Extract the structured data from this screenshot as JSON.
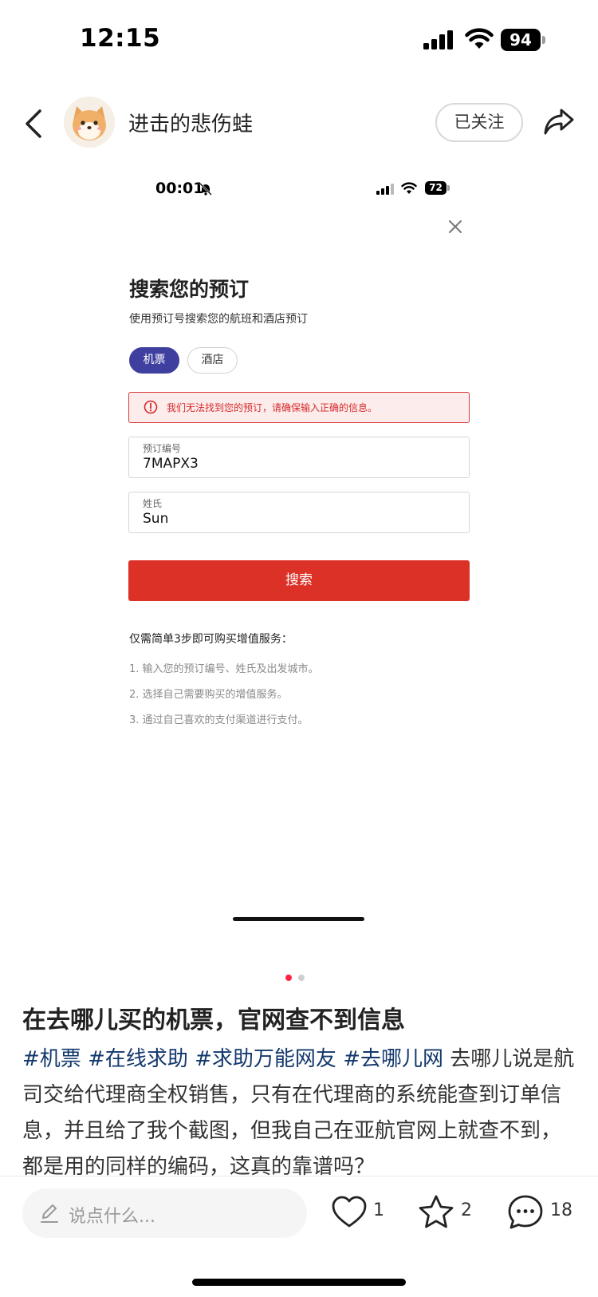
{
  "status_bar": {
    "time": "12:15",
    "battery": "94"
  },
  "header": {
    "author_name": "进击的悲伤蛙",
    "follow_label": "已关注"
  },
  "inner_screenshot": {
    "time": "00:01",
    "battery": "72",
    "title": "搜索您的预订",
    "subtitle": "使用预订号搜索您的航班和酒店预订",
    "tabs": [
      {
        "label": "机票",
        "selected": true
      },
      {
        "label": "酒店",
        "selected": false
      }
    ],
    "error_message": "我们无法找到您的预订，请确保输入正确的信息。",
    "fields": [
      {
        "label": "预订编号",
        "value": "7MAPX3"
      },
      {
        "label": "姓氏",
        "value": "Sun"
      }
    ],
    "search_button": "搜索",
    "steps_title": "仅需简单3步即可购买增值服务：",
    "steps": [
      "1. 输入您的预订编号、姓氏及出发城市。",
      "2. 选择自己需要购买的增值服务。",
      "3. 通过自己喜欢的支付渠道进行支付。"
    ]
  },
  "carousel": {
    "page_count": 2,
    "active_index": 0
  },
  "post": {
    "title": "在去哪儿买的机票，官网查不到信息",
    "tags": [
      "#机票",
      "#在线求助",
      "#求助万能网友",
      "#去哪儿网"
    ],
    "body": "去哪儿说是航司交给代理商全权销售，只有在代理商的系统能查到订单信息，并且给了我个截图，但我自己在亚航官网上就查不到，都是用的同样的编码，这真的靠谱吗？"
  },
  "bottom_bar": {
    "comment_placeholder": "说点什么...",
    "likes": "1",
    "collects": "2",
    "comments": "18"
  },
  "colors": {
    "accent_red": "#ff2442",
    "tag_blue": "#13386c",
    "tab_selected": "#3f3fa0",
    "search_button": "#dc3126",
    "error_red": "#d52b2b"
  },
  "icons": [
    "back-icon",
    "share-icon",
    "close-icon",
    "error-icon",
    "pencil-icon",
    "heart-icon",
    "star-icon",
    "comment-icon"
  ]
}
